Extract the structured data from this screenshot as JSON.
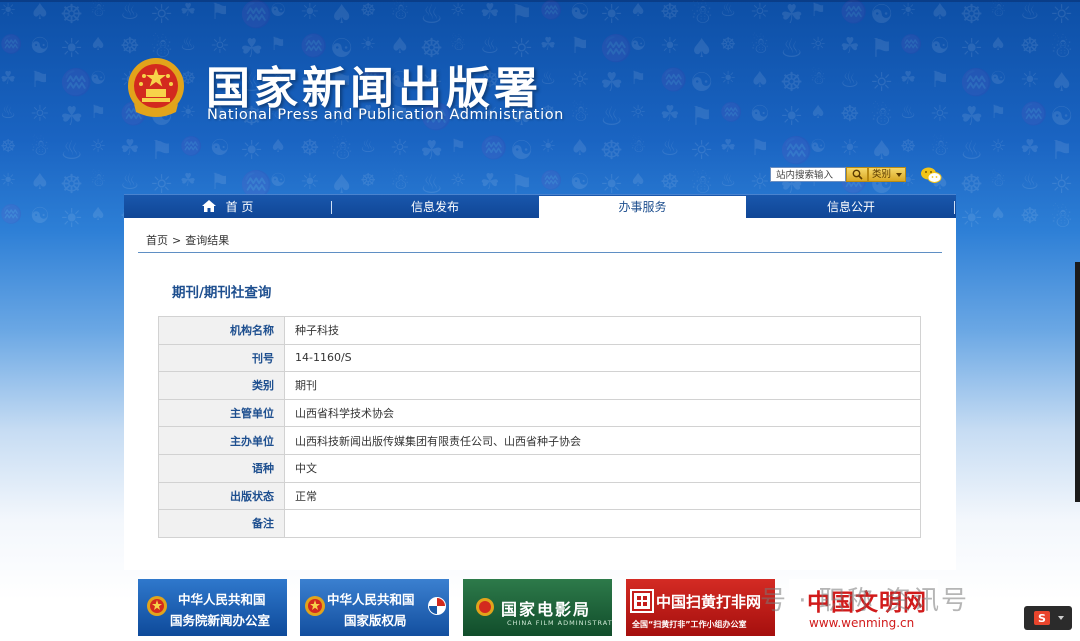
{
  "header": {
    "title": "国家新闻出版署",
    "subtitle": "National Press and Publication Administration"
  },
  "search": {
    "placeholder": "站内搜索输入",
    "category_label": "类别"
  },
  "nav": {
    "items": [
      {
        "label": "首 页",
        "icon": "home-icon"
      },
      {
        "label": "信息发布"
      },
      {
        "label": "办事服务",
        "active": true
      },
      {
        "label": "信息公开"
      }
    ]
  },
  "breadcrumb": {
    "home": "首页",
    "separator": ">",
    "current": "查询结果"
  },
  "section_title": "期刊/期刊社查询",
  "details": {
    "rows": [
      {
        "label": "机构名称",
        "value": "种子科技"
      },
      {
        "label": "刊号",
        "value": "14-1160/S"
      },
      {
        "label": "类别",
        "value": "期刊"
      },
      {
        "label": "主管单位",
        "value": "山西省科学技术协会"
      },
      {
        "label": "主办单位",
        "value": "山西科技新闻出版传媒集团有限责任公司、山西省种子协会"
      },
      {
        "label": "语种",
        "value": "中文"
      },
      {
        "label": "出版状态",
        "value": "正常"
      },
      {
        "label": "备注",
        "value": ""
      }
    ]
  },
  "footer_links": [
    {
      "line1": "中华人民共和国",
      "line2": "国务院新闻办公室",
      "color": "#1457a8"
    },
    {
      "line1": "中华人民共和国",
      "line2": "国家版权局",
      "color": "#1a5aa8"
    },
    {
      "line1": "国家电影局",
      "line2": "CHINA FILM ADMINISTRATION",
      "color": "#1d6a3d"
    },
    {
      "line1": "中国扫黄打非网",
      "line2": "全国“扫黄打非”工作小组办公室",
      "color": "#c41d1a"
    },
    {
      "line1": "中国文明网",
      "line2": "www.wenming.cn",
      "color": "#d11a1a"
    }
  ],
  "watermark": "号 · 职称 资讯号",
  "colors": {
    "brand_blue": "#0f4595",
    "label_blue": "#1e4f8f",
    "accent_gold": "#d9a824"
  }
}
